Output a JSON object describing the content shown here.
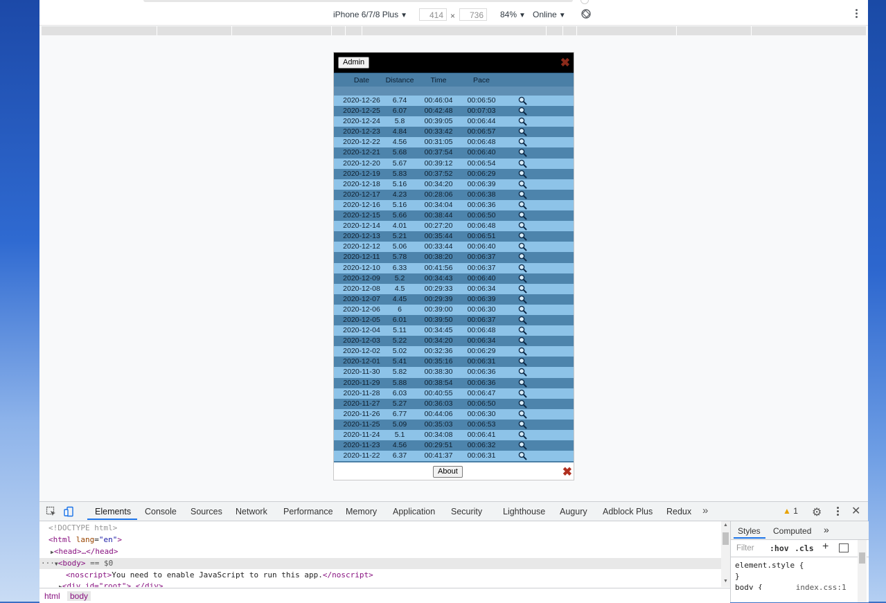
{
  "device_toolbar": {
    "device": "iPhone 6/7/8 Plus",
    "width": "414",
    "height": "736",
    "times": "×",
    "zoom": "84%",
    "throttle": "Online"
  },
  "app": {
    "admin_label": "Admin",
    "about_label": "About",
    "close_glyph": "✖",
    "columns": {
      "date": "Date",
      "distance": "Distance",
      "time": "Time",
      "pace": "Pace"
    },
    "runs": [
      {
        "date": "2020-12-26",
        "distance": "6.74",
        "time": "00:46:04",
        "pace": "00:06:50"
      },
      {
        "date": "2020-12-25",
        "distance": "6.07",
        "time": "00:42:48",
        "pace": "00:07:03"
      },
      {
        "date": "2020-12-24",
        "distance": "5.8",
        "time": "00:39:05",
        "pace": "00:06:44"
      },
      {
        "date": "2020-12-23",
        "distance": "4.84",
        "time": "00:33:42",
        "pace": "00:06:57"
      },
      {
        "date": "2020-12-22",
        "distance": "4.56",
        "time": "00:31:05",
        "pace": "00:06:48"
      },
      {
        "date": "2020-12-21",
        "distance": "5.68",
        "time": "00:37:54",
        "pace": "00:06:40"
      },
      {
        "date": "2020-12-20",
        "distance": "5.67",
        "time": "00:39:12",
        "pace": "00:06:54"
      },
      {
        "date": "2020-12-19",
        "distance": "5.83",
        "time": "00:37:52",
        "pace": "00:06:29"
      },
      {
        "date": "2020-12-18",
        "distance": "5.16",
        "time": "00:34:20",
        "pace": "00:06:39"
      },
      {
        "date": "2020-12-17",
        "distance": "4.23",
        "time": "00:28:06",
        "pace": "00:06:38"
      },
      {
        "date": "2020-12-16",
        "distance": "5.16",
        "time": "00:34:04",
        "pace": "00:06:36"
      },
      {
        "date": "2020-12-15",
        "distance": "5.66",
        "time": "00:38:44",
        "pace": "00:06:50"
      },
      {
        "date": "2020-12-14",
        "distance": "4.01",
        "time": "00:27:20",
        "pace": "00:06:48"
      },
      {
        "date": "2020-12-13",
        "distance": "5.21",
        "time": "00:35:44",
        "pace": "00:06:51"
      },
      {
        "date": "2020-12-12",
        "distance": "5.06",
        "time": "00:33:44",
        "pace": "00:06:40"
      },
      {
        "date": "2020-12-11",
        "distance": "5.78",
        "time": "00:38:20",
        "pace": "00:06:37"
      },
      {
        "date": "2020-12-10",
        "distance": "6.33",
        "time": "00:41:56",
        "pace": "00:06:37"
      },
      {
        "date": "2020-12-09",
        "distance": "5.2",
        "time": "00:34:43",
        "pace": "00:06:40"
      },
      {
        "date": "2020-12-08",
        "distance": "4.5",
        "time": "00:29:33",
        "pace": "00:06:34"
      },
      {
        "date": "2020-12-07",
        "distance": "4.45",
        "time": "00:29:39",
        "pace": "00:06:39"
      },
      {
        "date": "2020-12-06",
        "distance": "6",
        "time": "00:39:00",
        "pace": "00:06:30"
      },
      {
        "date": "2020-12-05",
        "distance": "6.01",
        "time": "00:39:50",
        "pace": "00:06:37"
      },
      {
        "date": "2020-12-04",
        "distance": "5.11",
        "time": "00:34:45",
        "pace": "00:06:48"
      },
      {
        "date": "2020-12-03",
        "distance": "5.22",
        "time": "00:34:20",
        "pace": "00:06:34"
      },
      {
        "date": "2020-12-02",
        "distance": "5.02",
        "time": "00:32:36",
        "pace": "00:06:29"
      },
      {
        "date": "2020-12-01",
        "distance": "5.41",
        "time": "00:35:16",
        "pace": "00:06:31"
      },
      {
        "date": "2020-11-30",
        "distance": "5.82",
        "time": "00:38:30",
        "pace": "00:06:36"
      },
      {
        "date": "2020-11-29",
        "distance": "5.88",
        "time": "00:38:54",
        "pace": "00:06:36"
      },
      {
        "date": "2020-11-28",
        "distance": "6.03",
        "time": "00:40:55",
        "pace": "00:06:47"
      },
      {
        "date": "2020-11-27",
        "distance": "5.27",
        "time": "00:36:03",
        "pace": "00:06:50"
      },
      {
        "date": "2020-11-26",
        "distance": "6.77",
        "time": "00:44:06",
        "pace": "00:06:30"
      },
      {
        "date": "2020-11-25",
        "distance": "5.09",
        "time": "00:35:03",
        "pace": "00:06:53"
      },
      {
        "date": "2020-11-24",
        "distance": "5.1",
        "time": "00:34:08",
        "pace": "00:06:41"
      },
      {
        "date": "2020-11-23",
        "distance": "4.56",
        "time": "00:29:51",
        "pace": "00:06:32"
      },
      {
        "date": "2020-11-22",
        "distance": "6.37",
        "time": "00:41:37",
        "pace": "00:06:31"
      }
    ]
  },
  "devtools": {
    "tabs": [
      "Elements",
      "Console",
      "Sources",
      "Network",
      "Performance",
      "Memory",
      "Application",
      "Security",
      "Lighthouse",
      "Augury",
      "Adblock Plus",
      "Redux"
    ],
    "more_tabs": "»",
    "warning_count": "1",
    "elements": {
      "doctype": "<!DOCTYPE html>",
      "html_open": "html",
      "lang_attr": "lang",
      "lang_value": "\"en\"",
      "head": "<head>…</head>",
      "body": "body",
      "body_suffix": "== $0",
      "noscript_open": "<noscript>",
      "noscript_text": "You need to enable JavaScript to run this app.",
      "noscript_close": "</noscript>",
      "root_div": "<div id=\"root\">…</div>"
    },
    "breadcrumbs": [
      "html",
      "body"
    ],
    "styles_tabs": [
      "Styles",
      "Computed"
    ],
    "filter_placeholder": "Filter",
    "hov": ":hov",
    "cls": ".cls",
    "element_style": "element.style {",
    "close_brace": "}",
    "body_rule": "body {",
    "body_rule_source": "index.css:1"
  },
  "colors": {
    "row_light": "#8dc3e8",
    "row_dark": "#4d84ac",
    "header": "#4a7fa6",
    "app_header": "#000000",
    "close_red": "#b03020",
    "devtools_accent": "#1a73e8"
  },
  "icons": [
    "magnifier-icon",
    "close-icon",
    "device-toolbar-icon",
    "inspect-icon",
    "rotate-icon",
    "warning-icon",
    "gear-icon",
    "kebab-icon"
  ]
}
